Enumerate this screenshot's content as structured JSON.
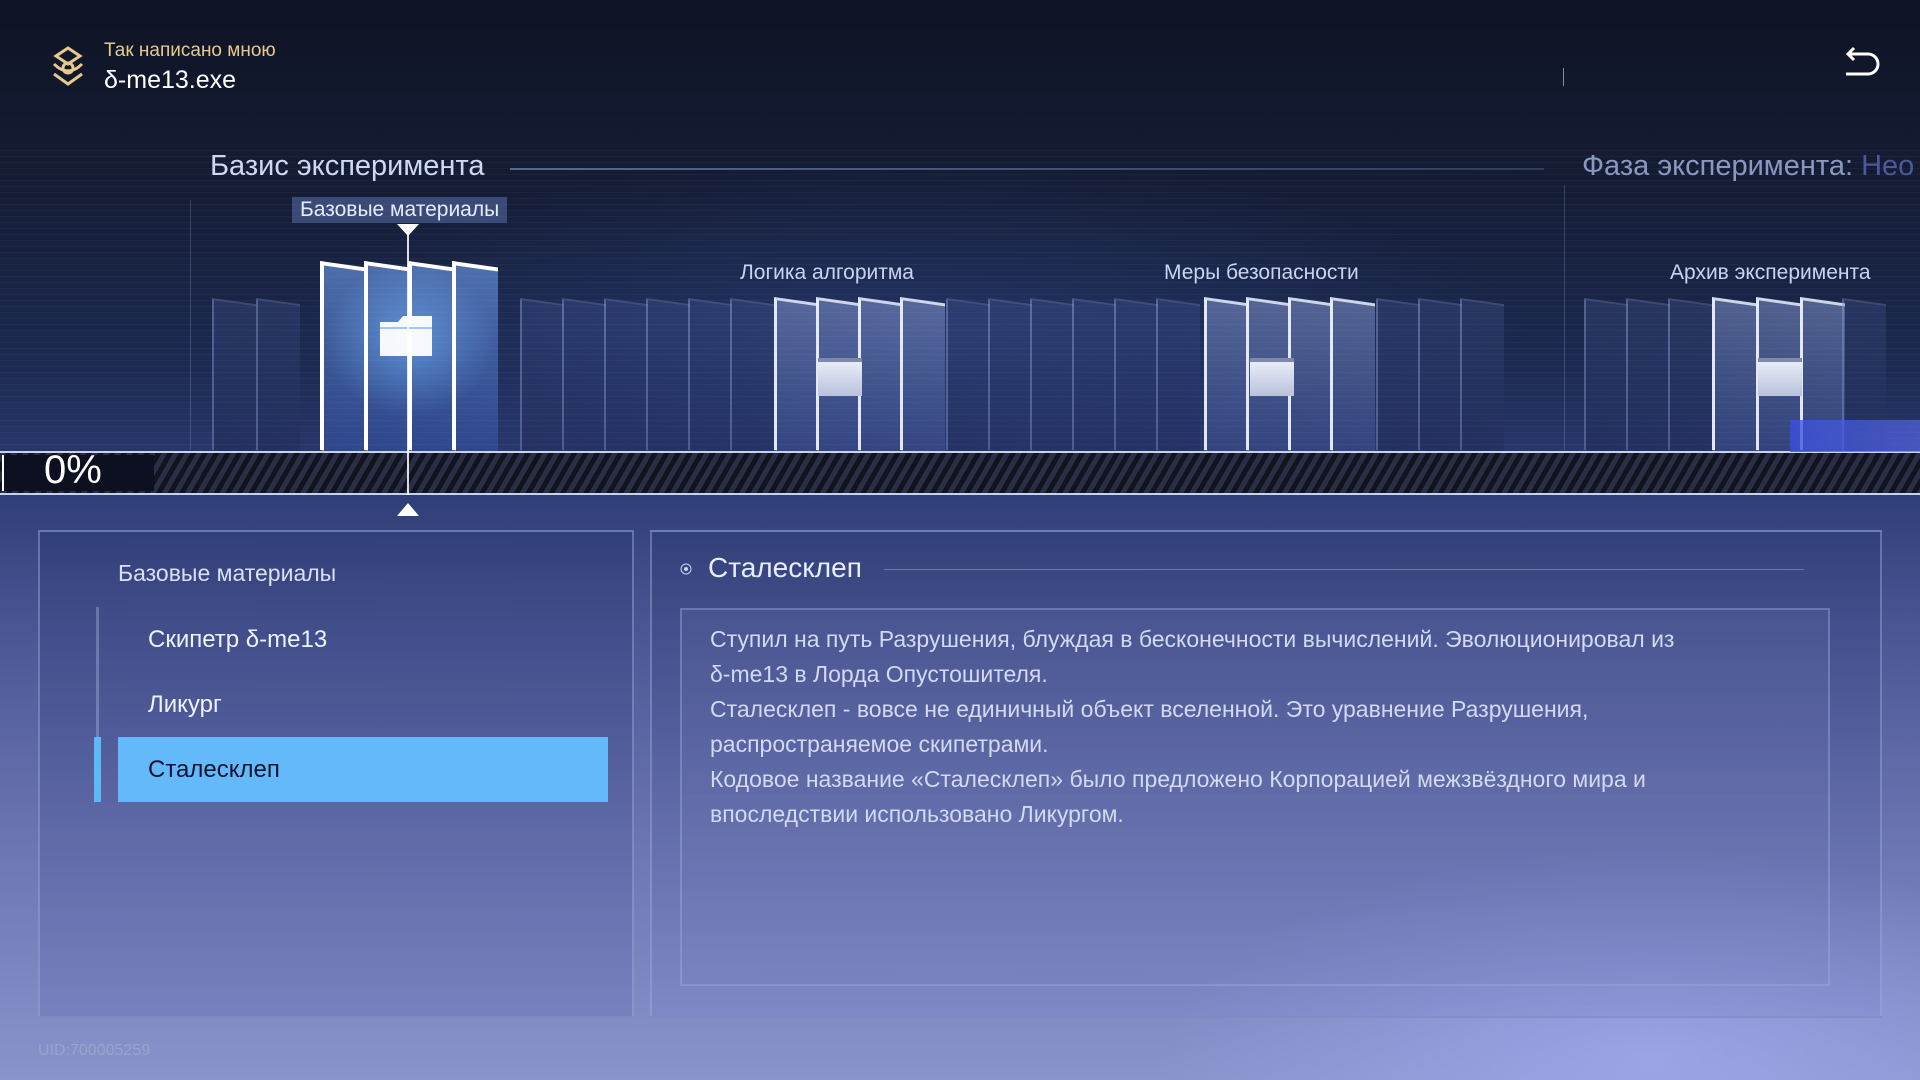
{
  "header": {
    "subtitle": "Так написано мною",
    "title": "δ-me13.exe",
    "logo_icon": "emblem-icon",
    "back_icon": "return-arrow-icon"
  },
  "phase": {
    "title": "Базис эксперимента",
    "next_title": "Фаза эксперимента:",
    "next_title_tail": "Нео"
  },
  "timeline": {
    "current_group": "Базовые материалы",
    "groups": [
      "Логика алгоритма",
      "Меры безопасности",
      "Архив эксперимента"
    ]
  },
  "progress": {
    "label": "0%",
    "fraction": 0
  },
  "left_panel": {
    "title": "Базовые материалы",
    "items": [
      {
        "label": "Скипетр δ-me13",
        "selected": false
      },
      {
        "label": "Ликург",
        "selected": false
      },
      {
        "label": "Сталесклеп",
        "selected": true
      }
    ]
  },
  "detail": {
    "title": "Сталесклеп",
    "lines": [
      "Ступил на путь Разрушения, блуждая в бесконечности вычислений. Эволюционировал из",
      "δ-me13 в Лорда Опустошителя.",
      "Сталесклеп - вовсе не единичный объект вселенной. Это уравнение Разрушения,",
      "распространяемое скипетрами.",
      "Кодовое название «Сталесклеп» было предложено Корпорацией межзвёздного мира и",
      "впоследствии использовано Ликургом."
    ]
  },
  "footer": {
    "uid": "UID:700005259"
  },
  "colors": {
    "accent": "#64b9fa",
    "gold": "#e7c98f"
  }
}
